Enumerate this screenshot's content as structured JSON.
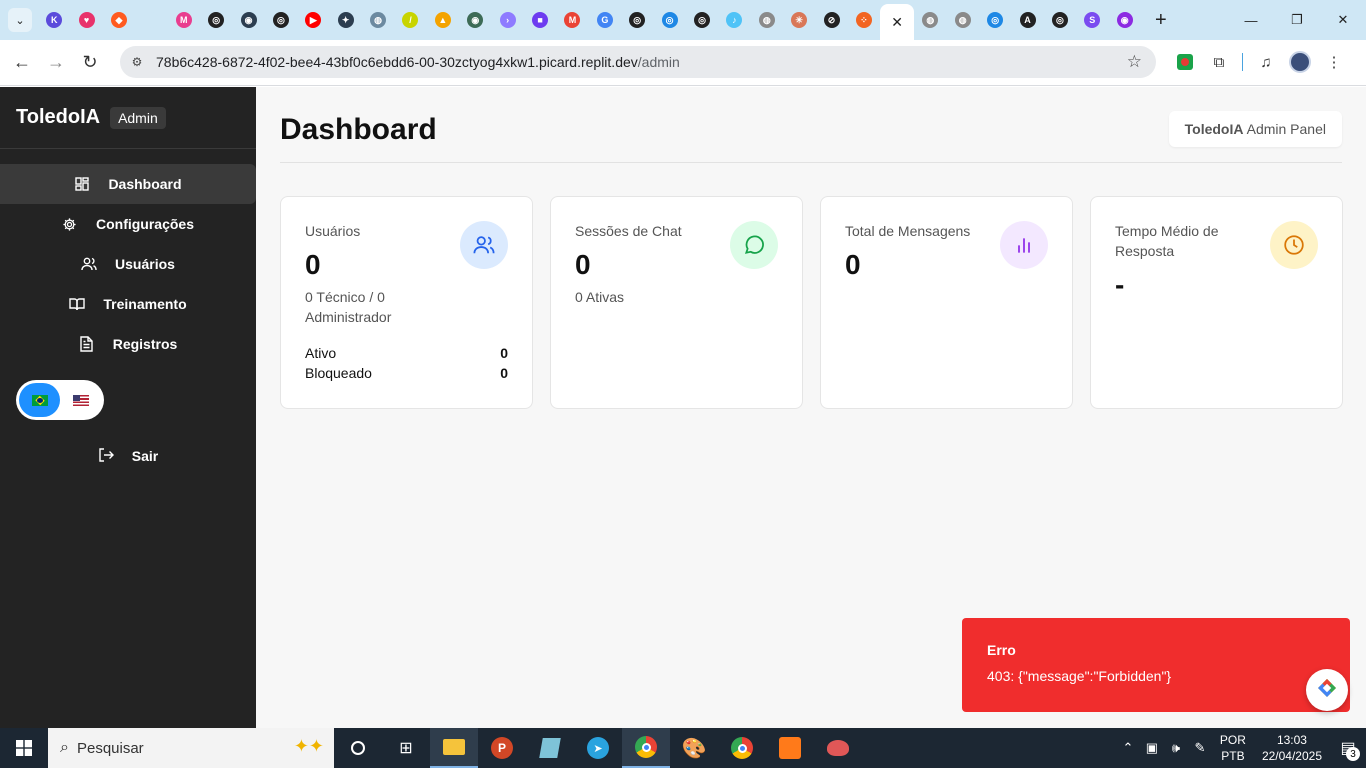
{
  "browser": {
    "tabs": [
      {
        "icon": "k-icon",
        "color": "#5b4bdb",
        "glyph": "K"
      },
      {
        "icon": "heart-icon",
        "color": "#e8336b",
        "glyph": "♥"
      },
      {
        "icon": "flame-icon",
        "color": "#ff5a1f",
        "glyph": "◆"
      },
      {
        "icon": "blank-icon",
        "color": "#cfe7f5",
        "glyph": ""
      },
      {
        "icon": "m-icon",
        "color": "#e93e8f",
        "glyph": "M"
      },
      {
        "icon": "openai-icon",
        "color": "#222222",
        "glyph": "◎"
      },
      {
        "icon": "circle-icon",
        "color": "#2c3e50",
        "glyph": "◉"
      },
      {
        "icon": "openai-icon",
        "color": "#222222",
        "glyph": "◎"
      },
      {
        "icon": "youtube-icon",
        "color": "#ff0000",
        "glyph": "▶"
      },
      {
        "icon": "gear-icon",
        "color": "#2c3e50",
        "glyph": "✦"
      },
      {
        "icon": "globe-icon",
        "color": "#6c8aa0",
        "glyph": "◍"
      },
      {
        "icon": "slash-icon",
        "color": "#c8d400",
        "glyph": "/"
      },
      {
        "icon": "triangle-icon",
        "color": "#f4a300",
        "glyph": "▲"
      },
      {
        "icon": "circle-icon",
        "color": "#3d6b56",
        "glyph": "◉"
      },
      {
        "icon": "arrow-icon",
        "color": "#8e7bff",
        "glyph": "›"
      },
      {
        "icon": "square-icon",
        "color": "#6d3cf0",
        "glyph": "■"
      },
      {
        "icon": "gmail-icon",
        "color": "#ea4335",
        "glyph": "M"
      },
      {
        "icon": "google-icon",
        "color": "#4285f4",
        "glyph": "G"
      },
      {
        "icon": "openai-icon",
        "color": "#222222",
        "glyph": "◎"
      },
      {
        "icon": "spiral-icon",
        "color": "#1e88e5",
        "glyph": "◎"
      },
      {
        "icon": "openai-icon",
        "color": "#222222",
        "glyph": "◎"
      },
      {
        "icon": "tiktok-icon",
        "color": "#4fc3f7",
        "glyph": "♪"
      },
      {
        "icon": "globe-icon",
        "color": "#8a8a8a",
        "glyph": "◍"
      },
      {
        "icon": "asterisk-icon",
        "color": "#d97757",
        "glyph": "✳"
      },
      {
        "icon": "perplexity-icon",
        "color": "#222222",
        "glyph": "⊘"
      },
      {
        "icon": "dots-icon",
        "color": "#f26522",
        "glyph": "⁘"
      }
    ],
    "tabs_after": [
      {
        "icon": "globe-icon",
        "color": "#8a8a8a",
        "glyph": "◍"
      },
      {
        "icon": "globe-icon",
        "color": "#8a8a8a",
        "glyph": "◍"
      },
      {
        "icon": "spiral-icon",
        "color": "#1e88e5",
        "glyph": "◎"
      },
      {
        "icon": "a-icon",
        "color": "#222222",
        "glyph": "A"
      },
      {
        "icon": "openai-icon",
        "color": "#222222",
        "glyph": "◎"
      },
      {
        "icon": "s-icon",
        "color": "#7a4cf0",
        "glyph": "S"
      },
      {
        "icon": "eye-icon",
        "color": "#8c2be2",
        "glyph": "◉"
      }
    ],
    "url_host": "78b6c428-6872-4f02-bee4-43bf0c6ebdd6-00-30zctyog4xkw1.picard.replit.dev",
    "url_path": "/admin"
  },
  "sidebar": {
    "brand": "ToledoIA",
    "badge": "Admin",
    "items": [
      {
        "label": "Dashboard",
        "icon": "grid-icon",
        "active": true
      },
      {
        "label": "Configurações",
        "icon": "gear-icon",
        "active": false
      },
      {
        "label": "Usuários",
        "icon": "users-icon",
        "active": false
      },
      {
        "label": "Treinamento",
        "icon": "book-icon",
        "active": false
      },
      {
        "label": "Registros",
        "icon": "document-icon",
        "active": false
      }
    ],
    "logout": "Sair"
  },
  "main": {
    "title": "Dashboard",
    "chip_brand": "ToledoIA",
    "chip_text": "Admin Panel",
    "cards": [
      {
        "label": "Usuários",
        "value": "0",
        "sub": "0 Técnico / 0 Administrador",
        "icon": "users-icon",
        "icon_bg": "#dbeafe",
        "icon_color": "#2563eb",
        "rows": [
          {
            "label": "Ativo",
            "value": "0"
          },
          {
            "label": "Bloqueado",
            "value": "0"
          }
        ]
      },
      {
        "label": "Sessões de Chat",
        "value": "0",
        "sub": "0 Ativas",
        "icon": "chat-icon",
        "icon_bg": "#dcfce7",
        "icon_color": "#16a34a",
        "rows": []
      },
      {
        "label": "Total de Mensagens",
        "value": "0",
        "sub": "",
        "icon": "bar-chart-icon",
        "icon_bg": "#f3e8ff",
        "icon_color": "#9333ea",
        "rows": []
      },
      {
        "label": "Tempo Médio de Resposta",
        "value": "-",
        "sub": "",
        "icon": "clock-icon",
        "icon_bg": "#fef3c7",
        "icon_color": "#d97706",
        "rows": []
      }
    ]
  },
  "toast": {
    "title": "Erro",
    "message": "403: {\"message\":\"Forbidden\"}"
  },
  "taskbar": {
    "search_placeholder": "Pesquisar",
    "lang_top": "POR",
    "lang_bottom": "PTB",
    "time": "13:03",
    "date": "22/04/2025",
    "notifications": "3"
  }
}
